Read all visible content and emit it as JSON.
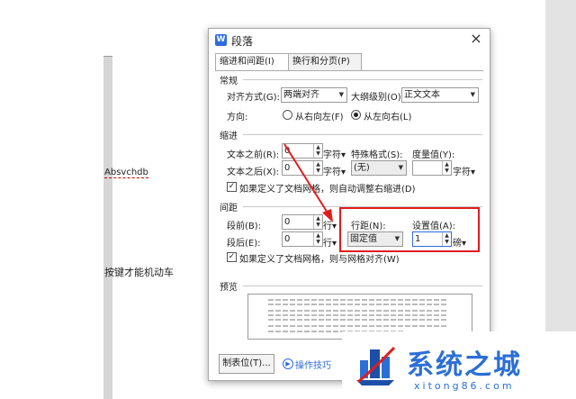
{
  "document": {
    "line1": "Absvchdb",
    "line2": "按键才能机动车"
  },
  "dialog": {
    "logo": "W",
    "title": "段落",
    "close": "×",
    "tabs": [
      "缩进和间距(I)",
      "换行和分页(P)"
    ],
    "general": {
      "heading": "常规",
      "align_label": "对齐方式(G):",
      "align_value": "两端对齐",
      "outline_label": "大纲级别(O):",
      "outline_value": "正文文本",
      "direction_label": "方向:",
      "rtl_label": "从右向左(F)",
      "ltr_label": "从左向右(L)"
    },
    "indent": {
      "heading": "缩进",
      "before_label": "文本之前(R):",
      "before_value": "0",
      "before_unit": "字符▾",
      "after_label": "文本之后(X):",
      "after_value": "0",
      "after_unit": "字符▾",
      "special_label": "特殊格式(S):",
      "special_value": "(无)",
      "measure_label": "度量值(Y):",
      "measure_value": "",
      "measure_unit": "字符▾",
      "grid_check": "如果定义了文档网格，则自动调整右缩进(D)"
    },
    "spacing": {
      "heading": "间距",
      "before_label": "段前(B):",
      "before_value": "0",
      "before_unit": "行▾",
      "after_label": "段后(E):",
      "after_value": "0",
      "after_unit": "行▾",
      "line_label": "行距(N):",
      "line_value": "固定值",
      "set_label": "设置值(A):",
      "set_value": "1",
      "set_unit": "磅▾",
      "grid_check": "如果定义了文档网格，则与网格对齐(W)"
    },
    "preview": {
      "heading": "预览"
    },
    "tab_stops_button": "制表位(T)...",
    "tips_link": "操作技巧"
  },
  "watermark": {
    "text": "系统之城",
    "url": "xitong86.com"
  },
  "colors": {
    "highlight": "#e21c1c",
    "brand": "#2b6fd6"
  }
}
